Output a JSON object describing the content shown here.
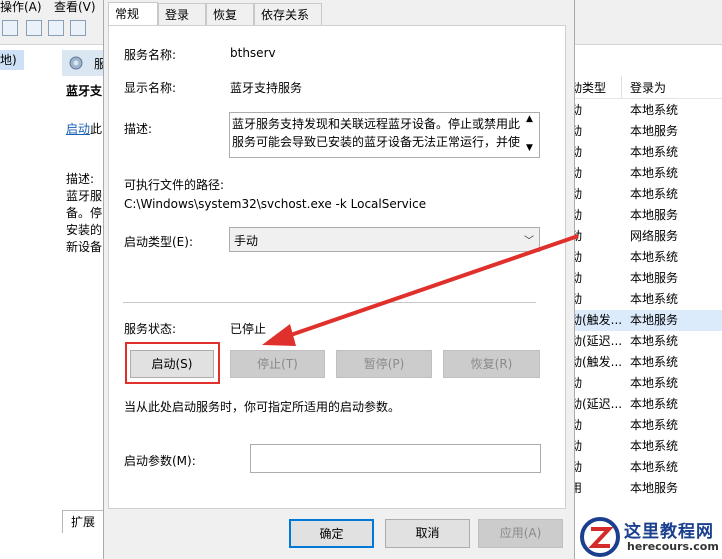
{
  "menubar": {
    "items": [
      "操作(A)",
      "查看(V)"
    ]
  },
  "leftpane": {
    "selected_label": "地)"
  },
  "midpane": {
    "header_glyph": "服",
    "service_title": "蓝牙支",
    "link_text": "启动",
    "link_suffix": "此",
    "desc_lines": [
      "描述:",
      "蓝牙服",
      "备。停",
      "安装的",
      "新设备"
    ],
    "tab_extended": "扩展"
  },
  "service_list": {
    "columns": [
      "动类型",
      "登录为"
    ],
    "rows": [
      {
        "type": "动",
        "logon": "本地系统"
      },
      {
        "type": "动",
        "logon": "本地服务"
      },
      {
        "type": "动",
        "logon": "本地系统"
      },
      {
        "type": "动",
        "logon": "本地系统"
      },
      {
        "type": "动",
        "logon": "本地系统"
      },
      {
        "type": "动",
        "logon": "本地服务"
      },
      {
        "type": "动",
        "logon": "网络服务"
      },
      {
        "type": "动",
        "logon": "本地系统"
      },
      {
        "type": "动",
        "logon": "本地服务"
      },
      {
        "type": "动",
        "logon": "本地系统"
      },
      {
        "type": "动(触发...",
        "logon": "本地服务"
      },
      {
        "type": "动(延迟...",
        "logon": "本地系统"
      },
      {
        "type": "动(触发...",
        "logon": "本地系统"
      },
      {
        "type": "动",
        "logon": "本地系统"
      },
      {
        "type": "动(延迟...",
        "logon": "本地系统"
      },
      {
        "type": "动",
        "logon": "本地系统"
      },
      {
        "type": "动",
        "logon": "本地系统"
      },
      {
        "type": "动",
        "logon": "本地系统"
      },
      {
        "type": "用",
        "logon": "本地服务"
      }
    ],
    "highlight_index": 10
  },
  "dialog": {
    "tabs": [
      "常规",
      "登录",
      "恢复",
      "依存关系"
    ],
    "service_name_label": "服务名称:",
    "service_name": "bthserv",
    "display_name_label": "显示名称:",
    "display_name": "蓝牙支持服务",
    "description_label": "描述:",
    "description": "蓝牙服务支持发现和关联远程蓝牙设备。停止或禁用此服务可能会导致已安装的蓝牙设备无法正常运行，并使",
    "exe_path_label": "可执行文件的路径:",
    "exe_path": "C:\\Windows\\system32\\svchost.exe -k LocalService",
    "startup_type_label": "启动类型(E):",
    "startup_type": "手动",
    "status_label": "服务状态:",
    "status": "已停止",
    "buttons": {
      "start": "启动(S)",
      "stop": "停止(T)",
      "pause": "暂停(P)",
      "resume": "恢复(R)"
    },
    "hint": "当从此处启动服务时，你可指定所适用的启动参数。",
    "params_label": "启动参数(M):",
    "params_value": "",
    "ok": "确定",
    "cancel": "取消",
    "apply": "应用(A)"
  },
  "watermark": {
    "title": "这里教程网",
    "url": "herecours.com"
  },
  "colors": {
    "annotation_red": "#e0302b",
    "focus_blue": "#0078d7"
  }
}
